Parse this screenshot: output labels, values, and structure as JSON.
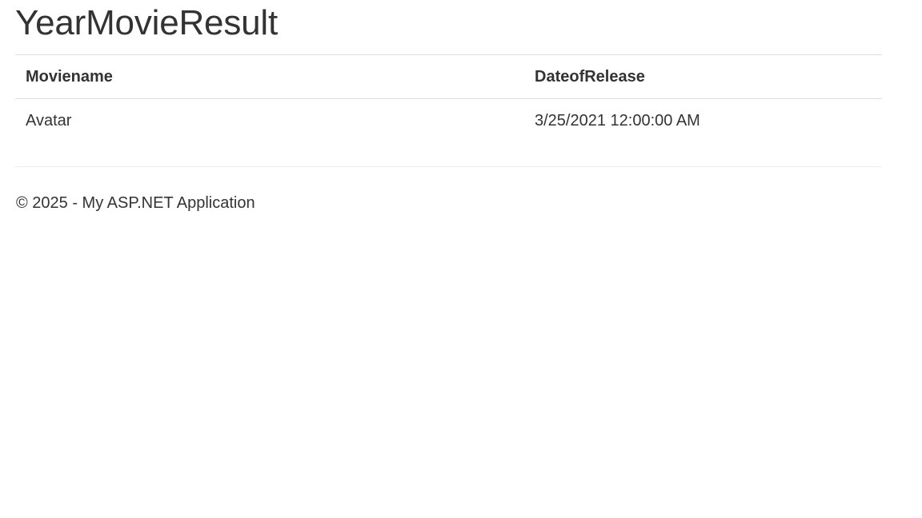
{
  "page": {
    "title": "YearMovieResult"
  },
  "table": {
    "headers": [
      "Moviename",
      "DateofRelease"
    ],
    "rows": [
      [
        "Avatar",
        "3/25/2021 12:00:00 AM"
      ]
    ]
  },
  "footer": {
    "text": "© 2025 - My ASP.NET Application"
  }
}
